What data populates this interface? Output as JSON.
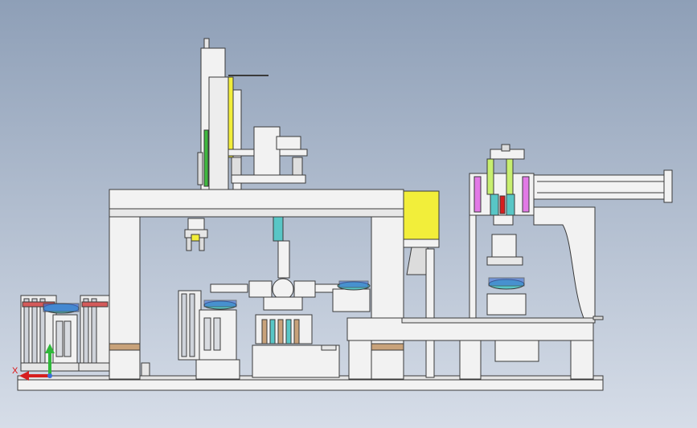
{
  "viewport": {
    "background_top": "#8e9fb7",
    "background_bottom": "#d6dde8"
  },
  "colors": {
    "frame": "#f2f2f2",
    "outline": "#3a3a3a",
    "yellow": "#f2ee3a",
    "green": "#3fb83f",
    "light_green": "#c8ef70",
    "magenta": "#e27ae6",
    "cyan": "#58c6c6",
    "blue": "#3c6fd6",
    "tan": "#c8a27a",
    "steel": "#c9ccd2",
    "red": "#d61f1f"
  },
  "axis_triad": {
    "x_label": "X",
    "icon_name": "axis-triad-icon"
  }
}
